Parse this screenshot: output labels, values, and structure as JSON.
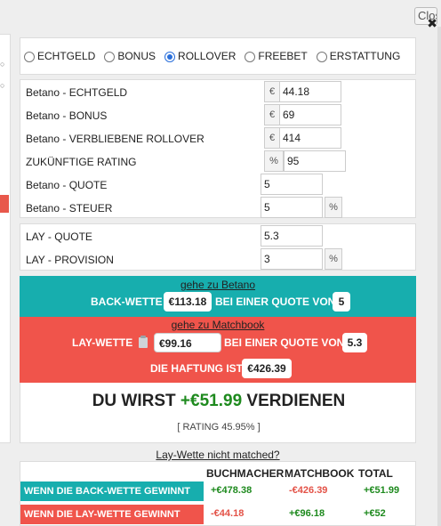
{
  "window": {
    "close_label": "Close",
    "close_x": "✖"
  },
  "modes": {
    "options": [
      {
        "label": "ECHTGELD",
        "checked": false
      },
      {
        "label": "BONUS",
        "checked": false
      },
      {
        "label": "ROLLOVER",
        "checked": true
      },
      {
        "label": "FREEBET",
        "checked": false
      },
      {
        "label": "ERSTATTUNG",
        "checked": false
      }
    ]
  },
  "back_inputs": {
    "echtgeld": {
      "label": "Betano - ECHTGELD",
      "addon": "€",
      "value": "44.18"
    },
    "bonus": {
      "label": "Betano - BONUS",
      "addon": "€",
      "value": "69"
    },
    "rollover": {
      "label": "Betano - VERBLIEBENE ROLLOVER",
      "addon": "€",
      "value": "414"
    },
    "rating": {
      "label": "ZUKÜNFTIGE RATING",
      "addon": "%",
      "value": "95"
    },
    "quote": {
      "label": "Betano - QUOTE",
      "value": "5"
    },
    "steuer": {
      "label": "Betano - STEUER",
      "value": "5",
      "addon": "%"
    }
  },
  "lay_inputs": {
    "quote": {
      "label": "LAY - QUOTE",
      "value": "5.3"
    },
    "provision": {
      "label": "LAY - PROVISION",
      "value": "3",
      "addon": "%"
    }
  },
  "back_bet": {
    "link": "gehe zu Betano",
    "label": "BACK-WETTE",
    "amount": "€113.18",
    "odds_text": "BEI EINER QUOTE VON",
    "odds": "5"
  },
  "lay_bet": {
    "link": "gehe zu Matchbook",
    "label": "LAY-WETTE",
    "amount": "€99.16",
    "odds_text": "BEI EINER QUOTE VON",
    "odds": "5.3",
    "liability_text": "DIE HAFTUNG IST",
    "liability": "€426.39"
  },
  "result": {
    "prefix": "DU WIRST",
    "profit": "+€51.99",
    "suffix": "VERDIENEN",
    "rating": "[ RATING 45.95% ]"
  },
  "not_matched_link": "Lay-Wette nicht matched?",
  "outcome_table": {
    "headers": [
      "BUCHMACHER",
      "MATCHBOOK",
      "TOTAL"
    ],
    "rows": [
      {
        "label": "WENN DIE BACK-WETTE GEWINNT",
        "bookmaker": "+€478.38",
        "matchbook": "-€426.39",
        "total": "+€51.99"
      },
      {
        "label": "WENN DIE LAY-WETTE GEWINNT",
        "bookmaker": "-€44.18",
        "matchbook": "+€96.18",
        "total": "+€52"
      }
    ]
  },
  "colors": {
    "back": "#17aeae",
    "lay": "#f0544b",
    "profit": "#1e8a1e",
    "loss": "#e35247"
  }
}
